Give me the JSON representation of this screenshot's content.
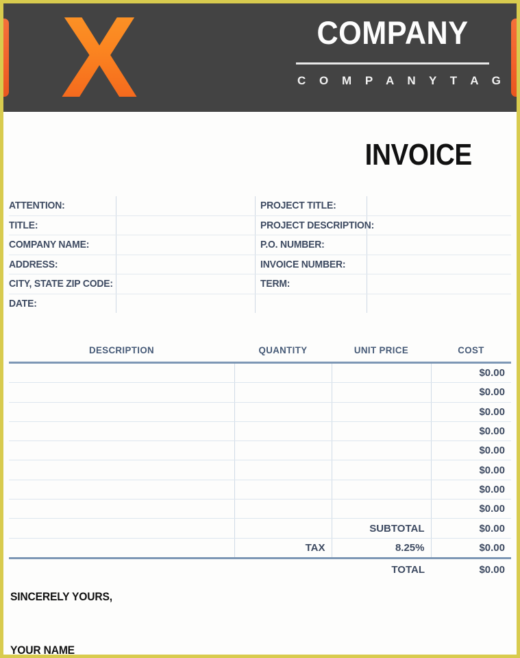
{
  "header": {
    "logo_letter": "X",
    "company_name": "COMPANY",
    "company_tag": "C O M P A N Y   T A G",
    "bar_color": "#434343",
    "tab_color": "#f2622c",
    "logo_color": "#fb8420"
  },
  "document": {
    "title": "INVOICE",
    "border_color": "#d8cb4e"
  },
  "info_fields": {
    "left": [
      "ATTENTION:",
      "TITLE:",
      "COMPANY NAME:",
      "ADDRESS:",
      "CITY, STATE ZIP CODE:",
      "DATE:"
    ],
    "right": [
      "PROJECT TITLE:",
      "PROJECT DESCRIPTION:",
      "P.O. NUMBER:",
      "INVOICE NUMBER:",
      "TERM:",
      ""
    ],
    "left_values": [
      "",
      "",
      "",
      "",
      "",
      ""
    ],
    "right_values": [
      "",
      "",
      "",
      "",
      "",
      ""
    ]
  },
  "items_table": {
    "columns": [
      "DESCRIPTION",
      "QUANTITY",
      "UNIT PRICE",
      "COST"
    ],
    "rows": [
      {
        "description": "",
        "quantity": "",
        "unit_price": "",
        "cost": "$0.00"
      },
      {
        "description": "",
        "quantity": "",
        "unit_price": "",
        "cost": "$0.00"
      },
      {
        "description": "",
        "quantity": "",
        "unit_price": "",
        "cost": "$0.00"
      },
      {
        "description": "",
        "quantity": "",
        "unit_price": "",
        "cost": "$0.00"
      },
      {
        "description": "",
        "quantity": "",
        "unit_price": "",
        "cost": "$0.00"
      },
      {
        "description": "",
        "quantity": "",
        "unit_price": "",
        "cost": "$0.00"
      },
      {
        "description": "",
        "quantity": "",
        "unit_price": "",
        "cost": "$0.00"
      },
      {
        "description": "",
        "quantity": "",
        "unit_price": "",
        "cost": "$0.00"
      }
    ],
    "summary": {
      "subtotal_label": "SUBTOTAL",
      "subtotal_value": "$0.00",
      "tax_label": "TAX",
      "tax_rate": "8.25%",
      "tax_value": "$0.00",
      "total_label": "TOTAL",
      "total_value": "$0.00"
    },
    "accent_rule_color": "#7d97b5",
    "text_color": "#3d4a61"
  },
  "footer": {
    "closing": "SINCERELY YOURS,",
    "signature_name": "YOUR NAME",
    "watermark": ""
  }
}
